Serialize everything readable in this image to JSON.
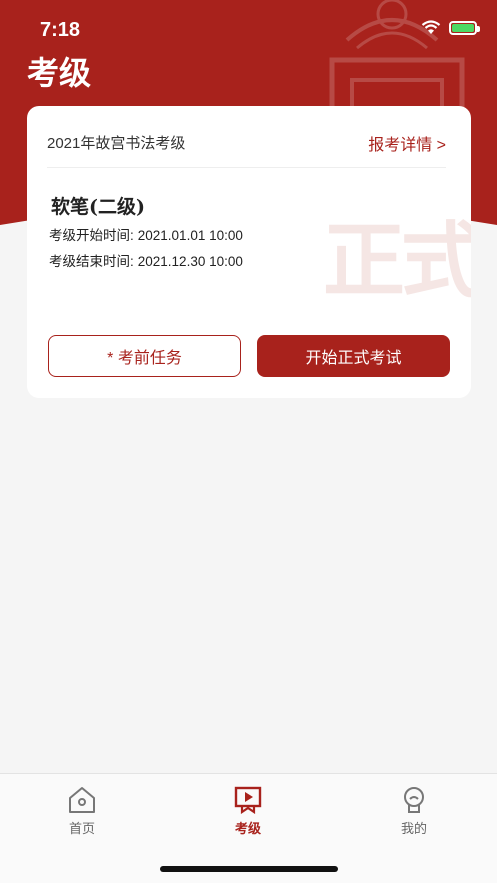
{
  "status_bar": {
    "time": "7:18"
  },
  "header": {
    "title": "考级"
  },
  "card": {
    "exam_name": "2021年故宫书法考级",
    "detail_link": "报考详情 >",
    "subject": "软笔(二级)",
    "start_label": "考级开始时间:",
    "start_value": "2021.01.01 10:00",
    "end_label": "考级结束时间:",
    "end_value": "2021.12.30 10:00",
    "watermark": "正式",
    "pre_task_button": "* 考前任务",
    "start_exam_button": "开始正式考试"
  },
  "tabbar": {
    "items": [
      {
        "label": "首页",
        "icon": "home-icon",
        "active": false
      },
      {
        "label": "考级",
        "icon": "exam-play-icon",
        "active": true
      },
      {
        "label": "我的",
        "icon": "profile-icon",
        "active": false
      }
    ]
  },
  "colors": {
    "brand": "#a8221c",
    "background": "#f5f5f5",
    "card": "#ffffff"
  }
}
